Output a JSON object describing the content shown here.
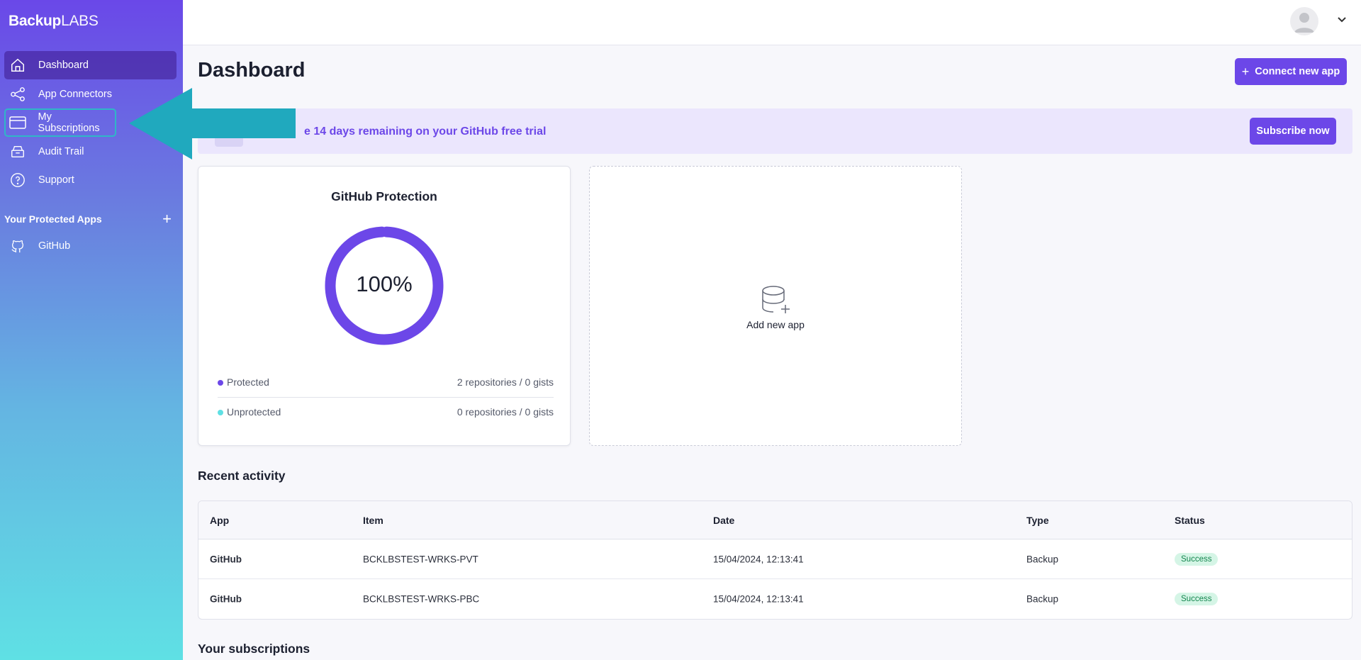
{
  "app": {
    "logo_bold": "Backup",
    "logo_light": "LABS"
  },
  "sidebar": {
    "items": [
      {
        "label": "Dashboard",
        "icon": "home-icon"
      },
      {
        "label": "App Connectors",
        "icon": "share-icon"
      },
      {
        "label": "My Subscriptions",
        "icon": "credit-card-icon"
      },
      {
        "label": "Audit Trail",
        "icon": "archive-icon"
      },
      {
        "label": "Support",
        "icon": "help-circle-icon"
      }
    ],
    "protected_title": "Your Protected Apps",
    "protected_apps": [
      {
        "label": "GitHub",
        "icon": "github-icon"
      }
    ]
  },
  "header": {
    "avatar_icon": "user-avatar-icon"
  },
  "main": {
    "title": "Dashboard",
    "connect_button": "Connect new app",
    "banner": {
      "text": "e 14 days remaining on your GitHub free trial",
      "button": "Subscribe now"
    },
    "protection_card": {
      "title": "GitHub Protection",
      "percent_label": "100%",
      "percent_value": 100,
      "legend": [
        {
          "label": "Protected",
          "value": "2 repositories / 0 gists",
          "color": "#6c47e8"
        },
        {
          "label": "Unprotected",
          "value": "0 repositories / 0 gists",
          "color": "#5fe0e4"
        }
      ]
    },
    "add_app_card": {
      "label": "Add new app"
    },
    "recent_activity": {
      "title": "Recent activity",
      "columns": [
        "App",
        "Item",
        "Date",
        "Type",
        "Status"
      ],
      "rows": [
        {
          "app": "GitHub",
          "item": "BCKLBSTEST-WRKS-PVT",
          "date": "15/04/2024, 12:13:41",
          "type": "Backup",
          "status": "Success"
        },
        {
          "app": "GitHub",
          "item": "BCKLBSTEST-WRKS-PBC",
          "date": "15/04/2024, 12:13:41",
          "type": "Backup",
          "status": "Success"
        }
      ]
    },
    "subscriptions_title": "Your subscriptions"
  },
  "colors": {
    "accent": "#6c47e8",
    "success_bg": "#d5f5e6",
    "success_text": "#14864e",
    "arrow": "#20a9be"
  }
}
